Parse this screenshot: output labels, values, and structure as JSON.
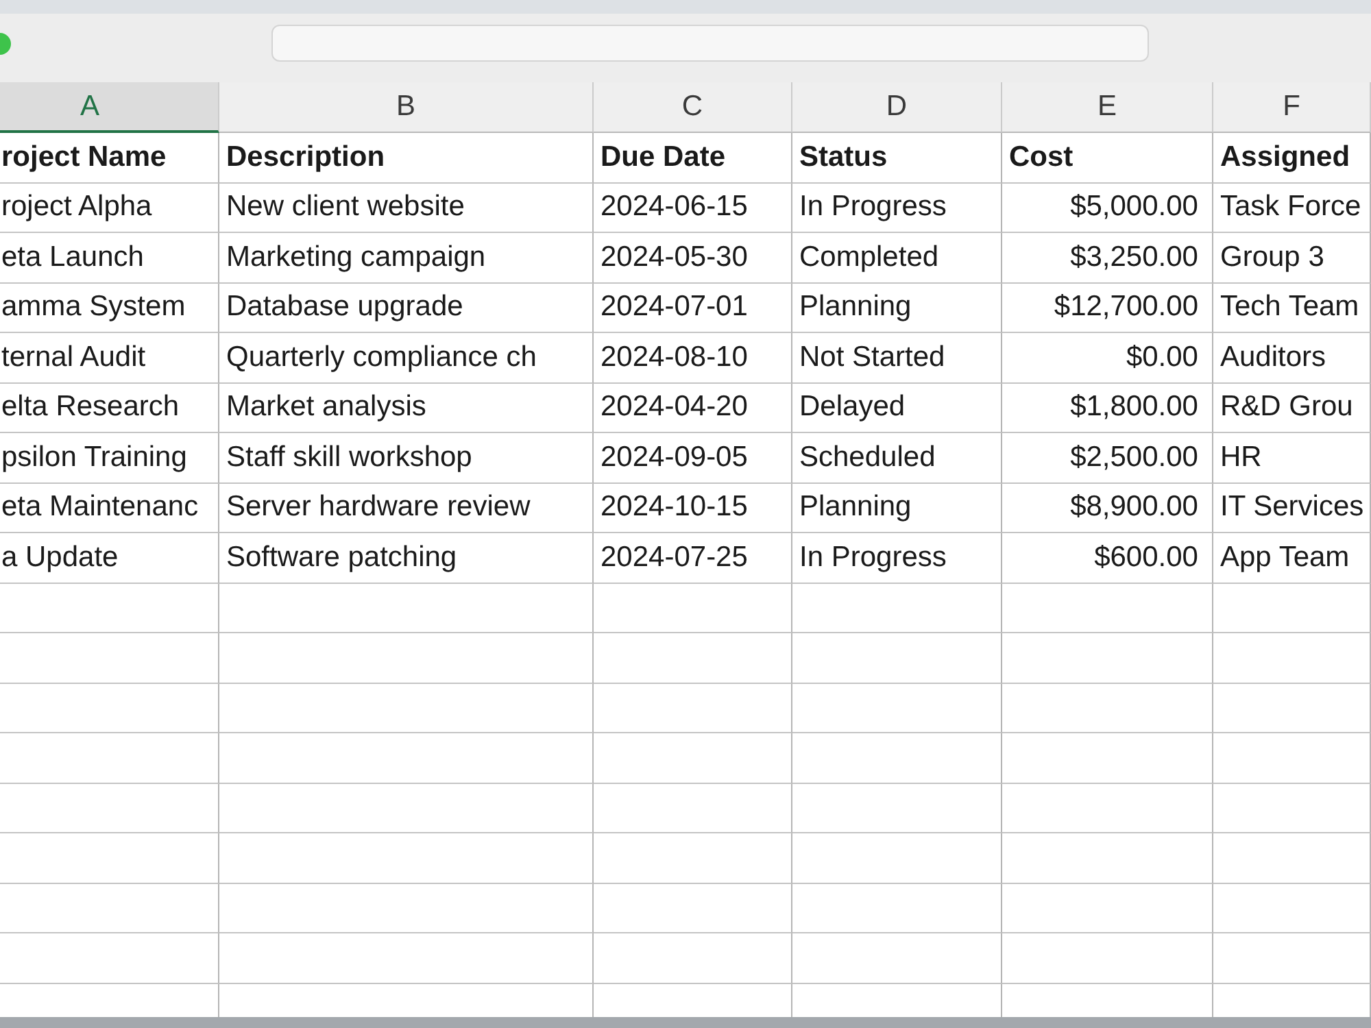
{
  "sheet": {
    "columns": [
      {
        "letter": "A",
        "selected": true,
        "kind": "text"
      },
      {
        "letter": "B",
        "selected": false,
        "kind": "text"
      },
      {
        "letter": "C",
        "selected": false,
        "kind": "text"
      },
      {
        "letter": "D",
        "selected": false,
        "kind": "text"
      },
      {
        "letter": "E",
        "selected": false,
        "kind": "currency"
      },
      {
        "letter": "F",
        "selected": false,
        "kind": "text"
      }
    ],
    "header_row": [
      "roject Name",
      "Description",
      "Due Date",
      "Status",
      "Cost",
      "Assigned"
    ],
    "rows": [
      [
        "roject Alpha",
        "New client website",
        "2024-06-15",
        "In Progress",
        "$5,000.00",
        "Task Force"
      ],
      [
        "eta Launch",
        "Marketing campaign",
        "2024-05-30",
        "Completed",
        "$3,250.00",
        "Group 3"
      ],
      [
        "amma System",
        "Database upgrade",
        "2024-07-01",
        "Planning",
        "$12,700.00",
        "Tech Team"
      ],
      [
        "ternal Audit",
        "Quarterly compliance ch",
        "2024-08-10",
        "Not Started",
        "$0.00",
        "Auditors"
      ],
      [
        "elta Research",
        "Market analysis",
        "2024-04-20",
        "Delayed",
        "$1,800.00",
        "R&D Grou"
      ],
      [
        "psilon Training",
        "Staff skill workshop",
        "2024-09-05",
        "Scheduled",
        "$2,500.00",
        "HR"
      ],
      [
        "eta Maintenanc",
        "Server hardware review",
        "2024-10-15",
        "Planning",
        "$8,900.00",
        "IT Services"
      ],
      [
        "a Update",
        "Software patching",
        "2024-07-25",
        "In Progress",
        "$600.00",
        "App Team"
      ]
    ]
  }
}
